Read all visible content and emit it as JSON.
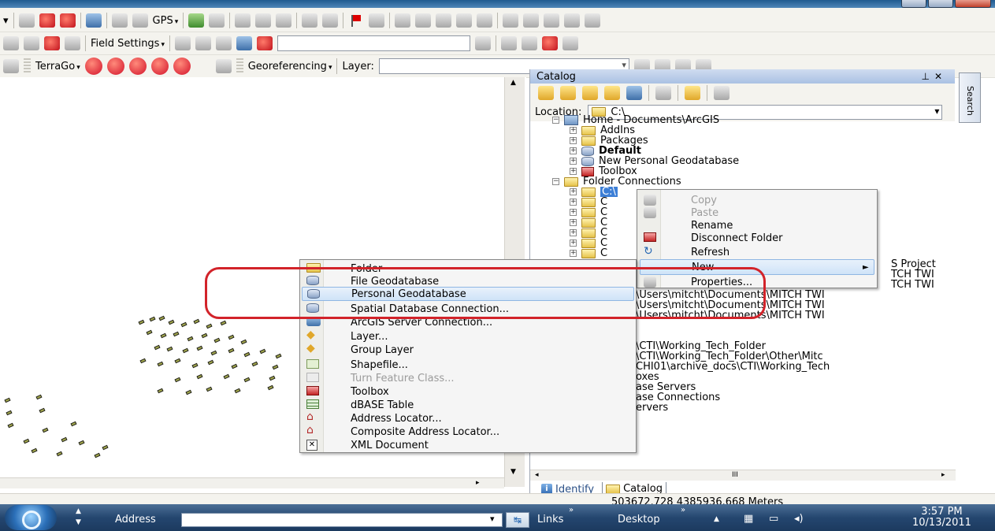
{
  "toolbar": {
    "gps_label": "GPS",
    "field_settings_label": "Field Settings",
    "terrago_label": "TerraGo",
    "georeferencing_label": "Georeferencing",
    "layer_label": "Layer:"
  },
  "catalog": {
    "title": "Catalog",
    "location_label": "Location:",
    "location_value": "C:\\",
    "tree": {
      "home": "Home - Documents\\ArcGIS",
      "addins": "AddIns",
      "packages": "Packages",
      "default": "Default",
      "new_pgdb": "New Personal Geodatabase",
      "toolbox": "Toolbox",
      "folder_connections": "Folder Connections",
      "c_root": "C:\\",
      "c_letter": "C"
    },
    "trailing_text": [
      "S Project",
      "TCH TWI",
      "TCH TWI",
      "\\Users\\mitcht\\Documents\\MITCH TWI",
      "\\Users\\mitcht\\Documents\\MITCH TWI",
      "\\Users\\mitcht\\Documents\\MITCH TWI",
      "\\CTI\\Working_Tech_Folder",
      "\\CTI\\Working_Tech_Folder\\Other\\Mitc",
      "CHI01\\archive_docs\\CTI\\Working_Tech",
      "oxes",
      "ase Servers",
      "ase Connections",
      "ervers"
    ],
    "tabs": {
      "identify": "Identify",
      "catalog": "Catalog"
    },
    "scroll_marker": "III"
  },
  "search_tab_label": "Search",
  "context_menu_main": {
    "copy": "Copy",
    "paste": "Paste",
    "rename": "Rename",
    "disconnect": "Disconnect Folder",
    "refresh": "Refresh",
    "new": "New",
    "properties": "Properties..."
  },
  "context_menu_new": {
    "folder": "Folder",
    "file_gdb": "File Geodatabase",
    "personal_gdb": "Personal Geodatabase",
    "sde": "Spatial Database Connection...",
    "ags": "ArcGIS Server Connection...",
    "layer": "Layer...",
    "group_layer": "Group Layer",
    "shapefile": "Shapefile...",
    "turn_feature": "Turn Feature Class...",
    "toolbox": "Toolbox",
    "dbase": "dBASE Table",
    "address_locator": "Address Locator...",
    "composite_locator": "Composite Address Locator...",
    "xml": "XML Document"
  },
  "status": {
    "coordinates": "503672.728  4385936.668 Meters"
  },
  "taskbar": {
    "address_label": "Address",
    "links_label": "Links",
    "desktop_label": "Desktop",
    "time": "3:57 PM",
    "date": "10/13/2011"
  },
  "colors": {
    "annotation_ring": "#d2232a",
    "selection": "#3d7fd6"
  }
}
